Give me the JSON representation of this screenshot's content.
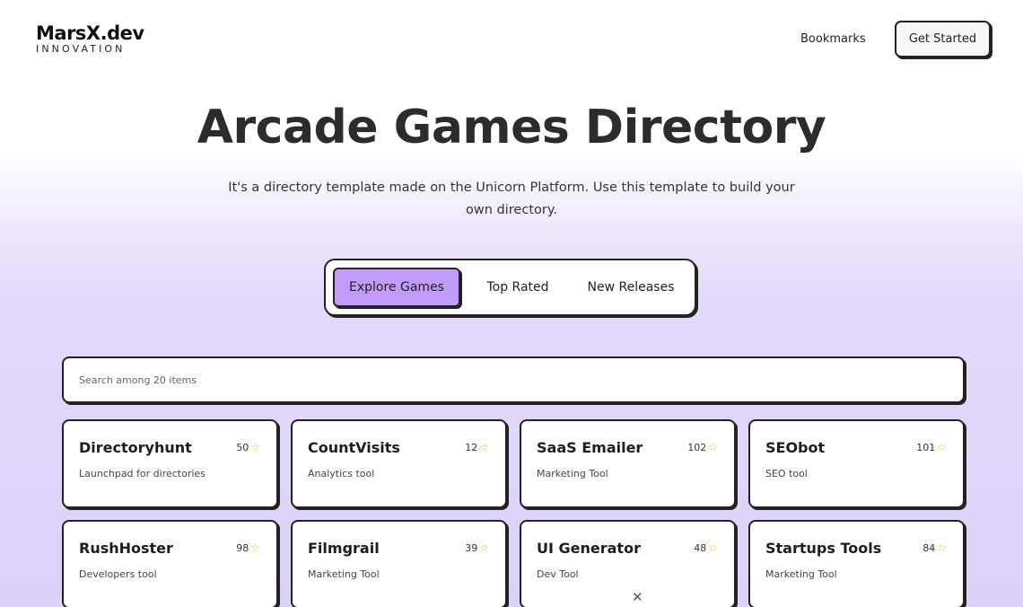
{
  "header": {
    "logo_main": "MarsX.dev",
    "logo_sub": "INNOVATION",
    "nav_bookmarks": "Bookmarks",
    "cta_label": "Get Started"
  },
  "hero": {
    "title": "Arcade Games Directory",
    "subtitle": "It's a directory template made on the Unicorn Platform. Use this template to build your own directory."
  },
  "tabs": [
    {
      "label": "Explore Games",
      "active": true
    },
    {
      "label": "Top Rated",
      "active": false
    },
    {
      "label": "New Releases",
      "active": false
    }
  ],
  "search": {
    "placeholder": "Search among 20 items",
    "value": ""
  },
  "cards": [
    {
      "name": "Directoryhunt",
      "desc": "Launchpad for directories",
      "count": "50"
    },
    {
      "name": "CountVisits",
      "desc": "Analytics tool",
      "count": "12"
    },
    {
      "name": "SaaS Emailer",
      "desc": "Marketing Tool",
      "count": "102"
    },
    {
      "name": "SEObot",
      "desc": "SEO tool",
      "count": "101"
    },
    {
      "name": "RushHoster",
      "desc": "Developers tool",
      "count": "98"
    },
    {
      "name": "Filmgrail",
      "desc": "Marketing Tool",
      "count": "39"
    },
    {
      "name": "UI Generator",
      "desc": "Dev Tool",
      "count": "48"
    },
    {
      "name": "Startups Tools",
      "desc": "Marketing Tool",
      "count": "84"
    }
  ],
  "icons": {
    "star": "star-icon",
    "close": "close-icon"
  },
  "colors": {
    "accent": "#c39bfb",
    "star": "#e9b92a",
    "border": "#222222"
  },
  "close_glyph": "✕"
}
